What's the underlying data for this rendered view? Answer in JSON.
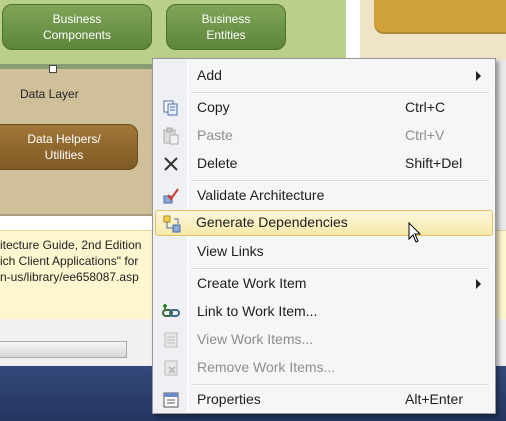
{
  "diagram": {
    "shapes": [
      {
        "label": "Business\nComponents"
      },
      {
        "label": "Business\nEntities"
      },
      {
        "label": "Data Helpers/\nUtilities"
      }
    ],
    "layer_label": "Data Layer",
    "info_lines": [
      "itecture Guide, 2nd Edition",
      "ich Client Applications\" for",
      "n-us/library/ee658087.asp"
    ]
  },
  "menu": {
    "items": [
      {
        "label": "Add",
        "shortcut": "",
        "icon": "add",
        "submenu": true,
        "disabled": false
      },
      {
        "label": "Copy",
        "shortcut": "Ctrl+C",
        "icon": "copy-icon",
        "disabled": false
      },
      {
        "label": "Paste",
        "shortcut": "Ctrl+V",
        "icon": "paste-icon",
        "disabled": true
      },
      {
        "label": "Delete",
        "shortcut": "Shift+Del",
        "icon": "delete-icon",
        "disabled": false
      },
      {
        "label": "Validate Architecture",
        "shortcut": "",
        "icon": "validate-icon",
        "disabled": false
      },
      {
        "label": "Generate Dependencies",
        "shortcut": "",
        "icon": "generate-dependencies-icon",
        "disabled": false,
        "hover": true
      },
      {
        "label": "View Links",
        "shortcut": "",
        "icon": "",
        "disabled": false
      },
      {
        "label": "Create Work Item",
        "shortcut": "",
        "icon": "",
        "submenu": true,
        "disabled": false
      },
      {
        "label": "Link to Work Item...",
        "shortcut": "",
        "icon": "link-work-item-icon",
        "disabled": false
      },
      {
        "label": "View Work Items...",
        "shortcut": "",
        "icon": "view-work-items-icon",
        "disabled": true
      },
      {
        "label": "Remove Work Items...",
        "shortcut": "",
        "icon": "remove-work-items-icon",
        "disabled": true
      },
      {
        "label": "Properties",
        "shortcut": "Alt+Enter",
        "icon": "properties-icon",
        "disabled": false
      }
    ]
  },
  "colors": {
    "menu_hover_border": "#e5c365",
    "green_shape": "#6c9448",
    "brown_shape": "#8f6a30"
  }
}
